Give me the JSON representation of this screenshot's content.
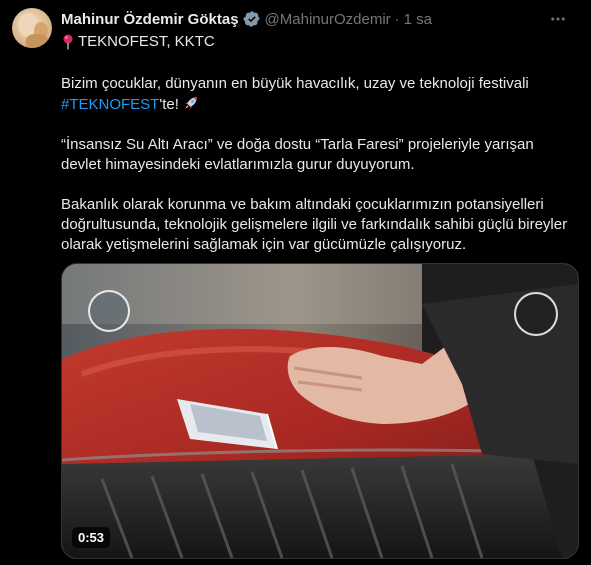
{
  "author": {
    "name": "Mahinur Özdemir Göktaş",
    "handle": "@MahinurOzdemir",
    "separator": "·",
    "time": "1 sa",
    "verified_color": "#829aab"
  },
  "location": "TEKNOFEST, KKTC",
  "text": {
    "p1_before": "Bizim çocuklar, dünyanın en büyük havacılık, uzay ve teknoloji festivali ",
    "p1_hashtag": "#TEKNOFEST",
    "p1_after": "'te!",
    "p2": "“İnsansız Su Altı Aracı” ve doğa dostu “Tarla Faresi” projeleriyle yarışan devlet himayesindeki evlatlarımızla gurur duyuyorum.",
    "p3": "Bakanlık olarak korunma ve bakım altındaki çocuklarımızın potansiyelleri doğrultusunda, teknolojik gelişmelere ilgili ve farkındalık sahibi güçlü bireyler olarak yetişmelerini sağlamak için var gücümüzle çalışıyoruz."
  },
  "media": {
    "duration": "0:53"
  },
  "colors": {
    "accent": "#1d9bf0",
    "muted": "#71767b",
    "background": "#000000"
  },
  "icons": {
    "more": "more-icon",
    "location": "pin-icon",
    "emoji": "rocket-icon",
    "verified": "verified-badge-icon"
  }
}
